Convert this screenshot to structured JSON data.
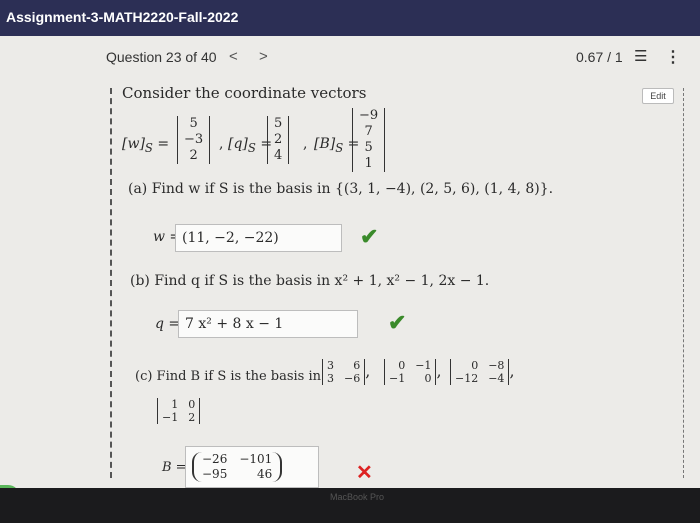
{
  "window": {
    "title": "Assignment-3-MATH2220-Fall-2022"
  },
  "nav": {
    "question_label": "Question 23 of 40",
    "prev": "<",
    "next": ">",
    "score": "0.67 / 1",
    "edit": "Edit"
  },
  "problem": {
    "intro": "Consider the coordinate vectors",
    "w_label": "[w]",
    "q_label": "[q]",
    "B_label": "[B]",
    "sub": "S",
    "w_vec": [
      "5",
      "−3",
      "2"
    ],
    "q_vec": [
      "5",
      "2",
      "4"
    ],
    "B_vec": [
      "−9",
      "7",
      "5",
      "1"
    ],
    "part_a": "(a) Find w if S is the basis in {(3, 1, −4), (2, 5, 6), (1, 4, 8)}.",
    "answer_a_label": "w =",
    "answer_a": "(11, −2, −22)",
    "part_b": "(b) Find q if S is the basis in x² + 1, x² − 1, 2x − 1.",
    "answer_b_label": "q =",
    "answer_b": "7 x² + 8 x − 1",
    "part_c": "(c) Find B if S is the basis in",
    "mats": [
      [
        "3",
        "6",
        "3",
        "−6"
      ],
      [
        "0",
        "−1",
        "−1",
        "0"
      ],
      [
        "0",
        "−8",
        "−12",
        "−4"
      ],
      [
        "1",
        "0",
        "−1",
        "2"
      ]
    ],
    "answer_c_label": "B =",
    "answer_c": [
      "−26",
      "−101",
      "−95",
      "46"
    ]
  },
  "footer": {
    "brand": "MacBook Pro"
  }
}
